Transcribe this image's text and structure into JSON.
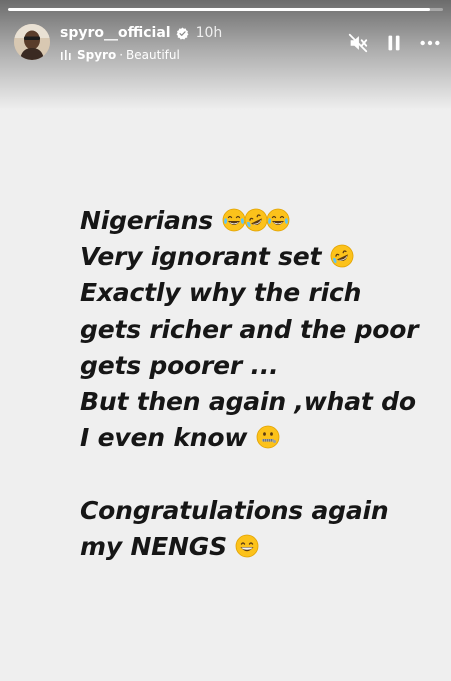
{
  "story": {
    "progress_fraction": 0.97,
    "user": {
      "username": "spyro__official",
      "verified": true,
      "time_ago": "10h"
    },
    "music": {
      "artist": "Spyro",
      "separator": "·",
      "song": "Beautiful"
    },
    "controls": [
      "mute-icon",
      "pause-icon",
      "more-icon"
    ],
    "text_lines": [
      "Nigerians",
      "Very ignorant set",
      "Exactly why the rich",
      "gets richer and the poor",
      "gets poorer ...",
      "But then again ,what do",
      "I even know",
      "",
      "Congratulations again",
      "my NENGS"
    ],
    "emojis": [
      "face-with-tears-of-joy",
      "rolling-on-the-floor-laughing",
      "face-with-tears-of-joy",
      "zipper-mouth-face",
      "grinning-face-with-smiling-eyes"
    ]
  },
  "colors": {
    "background": "#efefef",
    "text": "#161616",
    "emoji_yellow": "#fcc21b"
  }
}
